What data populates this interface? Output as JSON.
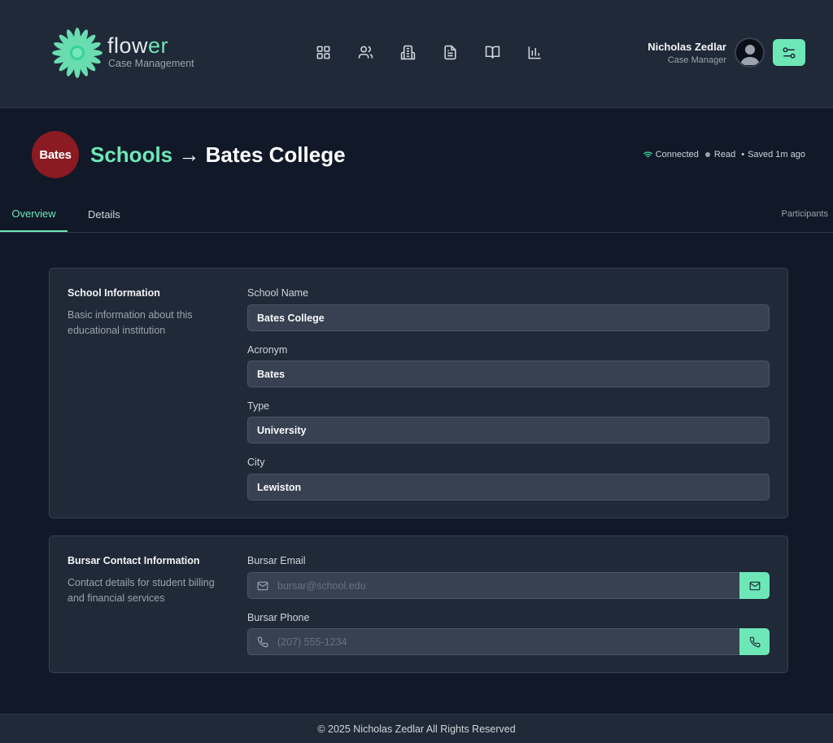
{
  "brand": {
    "name_prefix": "flow",
    "name_accent": "er",
    "subtitle": "Case Management",
    "accent_color": "#6ee7b7"
  },
  "nav": {
    "items": [
      {
        "icon": "dashboard-grid-icon"
      },
      {
        "icon": "people-icon"
      },
      {
        "icon": "building-icon"
      },
      {
        "icon": "document-icon"
      },
      {
        "icon": "book-icon"
      },
      {
        "icon": "bar-chart-icon"
      }
    ]
  },
  "user": {
    "name": "Nicholas Zedlar",
    "role": "Case Manager",
    "settings_icon": "toggle-settings-icon"
  },
  "page": {
    "badge": "Bates",
    "badge_color": "#8b1a22",
    "breadcrumb": "Schools",
    "arrow": "→",
    "title": "Bates College"
  },
  "status": {
    "connection": "Connected",
    "mode": "Read",
    "saved": "Saved 1m ago"
  },
  "tabs": {
    "overview": "Overview",
    "details": "Details",
    "participants": "Participants"
  },
  "school_info": {
    "title": "School Information",
    "description": "Basic information about this educational institution",
    "fields": [
      {
        "label": "School Name",
        "value": "Bates College"
      },
      {
        "label": "Acronym",
        "value": "Bates"
      },
      {
        "label": "Type",
        "value": "University"
      },
      {
        "label": "City",
        "value": "Lewiston"
      }
    ]
  },
  "bursar": {
    "title": "Bursar Contact Information",
    "description": "Contact details for student billing and financial services",
    "email_label": "Bursar Email",
    "email_placeholder": "bursar@school.edu",
    "phone_label": "Bursar Phone",
    "phone_placeholder": "(207) 555-1234"
  },
  "footer": {
    "text": "© 2025 Nicholas Zedlar All Rights Reserved"
  }
}
